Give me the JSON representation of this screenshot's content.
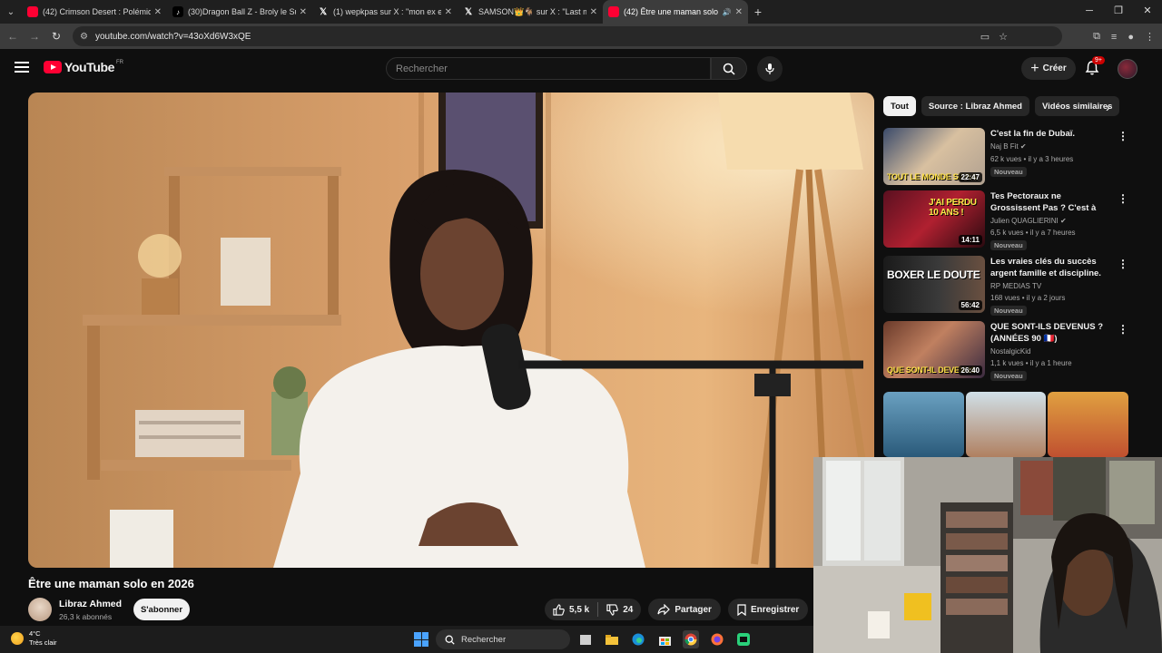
{
  "browser": {
    "tabs": [
      {
        "label": "(42) Crimson Desert : Polémiqu",
        "icon": "youtube-icon",
        "active": false
      },
      {
        "label": "(30)Dragon Ball Z - Broly le Sup",
        "icon": "tiktok-icon",
        "active": false
      },
      {
        "label": "(1) wepkpas sur X : \"mon ex ell",
        "icon": "x-icon",
        "active": false
      },
      {
        "label": "SAMSON👑🐐 sur X : \"Last m",
        "icon": "x-icon",
        "active": false
      },
      {
        "label": "(42) Être une maman solo e",
        "icon": "youtube-icon",
        "active": true
      }
    ],
    "url": "youtube.com/watch?v=43oXd6W3xQE"
  },
  "masthead": {
    "logo_text": "YouTube",
    "region": "FR",
    "search_placeholder": "Rechercher",
    "create_label": "Créer",
    "notifications_badge": "9+"
  },
  "video": {
    "title": "Être une maman solo en 2026",
    "channel": "Libraz Ahmed",
    "subscribers": "26,3 k abonnés",
    "subscribe_label": "S'abonner",
    "likes": "5,5 k",
    "dislikes": "24",
    "share_label": "Partager",
    "save_label": "Enregistrer"
  },
  "chips": [
    "Tout",
    "Source : Libraz Ahmed",
    "Vidéos similaires"
  ],
  "recommendations": [
    {
      "title": "C'est la fin de Dubaï.",
      "channel": "Naj B Fit",
      "verified": true,
      "meta": "62 k vues • il y a 3 heures",
      "badge": "Nouveau",
      "duration": "22:47",
      "thumb_text": "TOUT LE MONDE SE BA"
    },
    {
      "title": "Tes Pectoraux ne Grossissent Pas ? C'est à Cause de Ces ...",
      "channel": "Julien QUAGLIERINI",
      "verified": true,
      "meta": "6,5 k vues • il y a 7 heures",
      "badge": "Nouveau",
      "duration": "14:11",
      "thumb_text": "J'AI PERDU 10 ANS !"
    },
    {
      "title": "Les vraies clés du succès argent famille et discipline.",
      "channel": "RP MEDIAS TV",
      "verified": false,
      "meta": "168 vues • il y a 2 jours",
      "badge": "Nouveau",
      "duration": "56:42",
      "thumb_text": "BOXER LE DOUTE"
    },
    {
      "title": "QUE SONT-ILS DEVENUS ? (ANNÉES 90 🇫🇷)",
      "channel": "NostalgicKid",
      "verified": false,
      "meta": "1,1 k vues • il y a 1 heure",
      "badge": "Nouveau",
      "duration": "26:40",
      "thumb_text": "QUE SONT-IL DEVENUS"
    }
  ],
  "taskbar": {
    "weather_temp": "4°C",
    "weather_desc": "Très clair",
    "search_label": "Rechercher"
  },
  "colors": {
    "youtube_red": "#ff0033",
    "background": "#0f0f0f"
  }
}
